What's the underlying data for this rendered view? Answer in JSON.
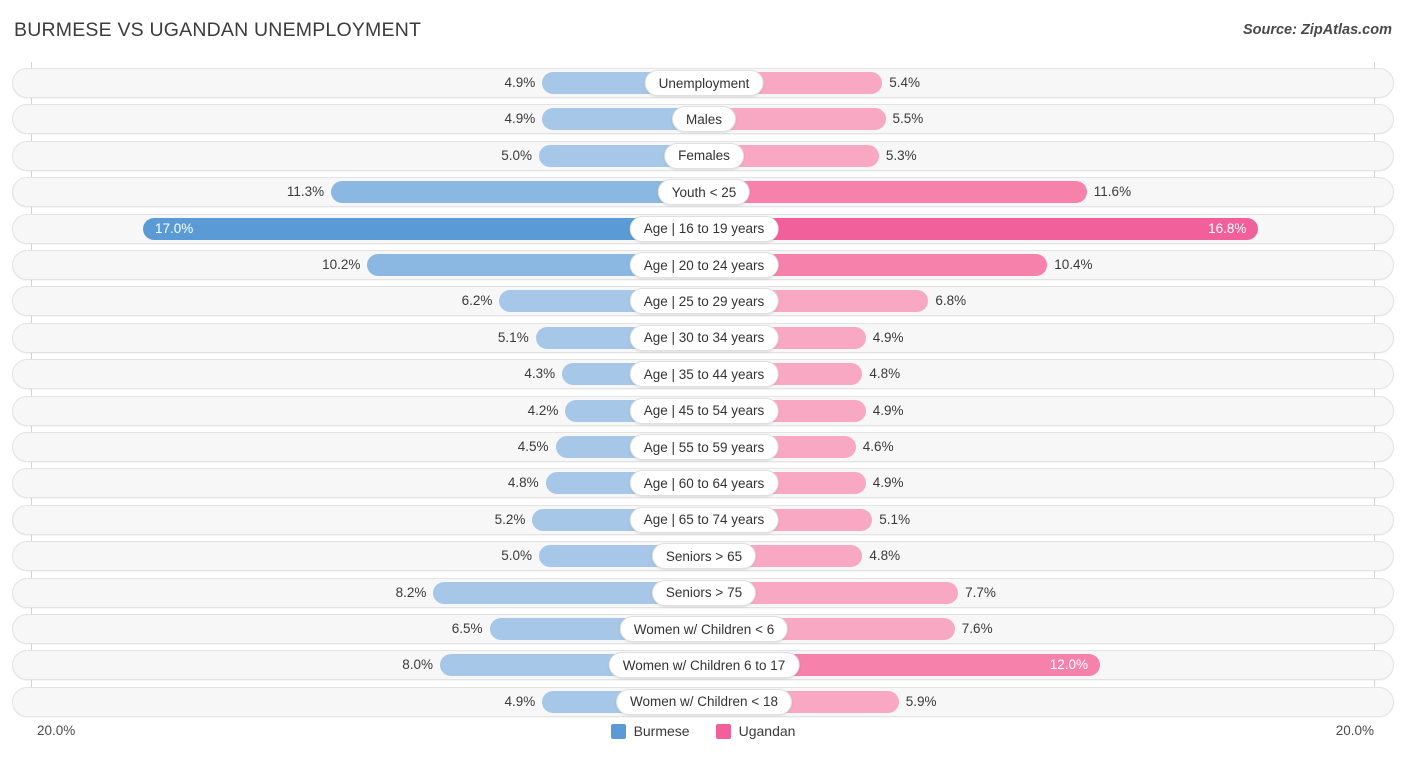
{
  "header": {
    "title": "BURMESE VS UGANDAN UNEMPLOYMENT",
    "source": "Source: ZipAtlas.com"
  },
  "legend": {
    "left": {
      "label": "Burmese",
      "color": "#5b9bd5"
    },
    "right": {
      "label": "Ugandan",
      "color": "#f2609b"
    }
  },
  "axis": {
    "left_label": "20.0%",
    "right_label": "20.0%",
    "max": 20.0
  },
  "chart_data": {
    "type": "bar",
    "orientation": "horizontal-diverging",
    "title": "BURMESE VS UGANDAN UNEMPLOYMENT",
    "xlabel": "",
    "ylabel": "",
    "xlim": [
      20.0,
      20.0
    ],
    "grid": false,
    "legend_position": "bottom-center",
    "categories": [
      "Unemployment",
      "Males",
      "Females",
      "Youth < 25",
      "Age | 16 to 19 years",
      "Age | 20 to 24 years",
      "Age | 25 to 29 years",
      "Age | 30 to 34 years",
      "Age | 35 to 44 years",
      "Age | 45 to 54 years",
      "Age | 55 to 59 years",
      "Age | 60 to 64 years",
      "Age | 65 to 74 years",
      "Seniors > 65",
      "Seniors > 75",
      "Women w/ Children < 6",
      "Women w/ Children 6 to 17",
      "Women w/ Children < 18"
    ],
    "series": [
      {
        "name": "Burmese",
        "color": "#5b9bd5",
        "values": [
          4.9,
          4.9,
          5.0,
          11.3,
          17.0,
          10.2,
          6.2,
          5.1,
          4.3,
          4.2,
          4.5,
          4.8,
          5.2,
          5.0,
          8.2,
          6.5,
          8.0,
          4.9
        ],
        "labels": [
          "4.9%",
          "4.9%",
          "5.0%",
          "11.3%",
          "17.0%",
          "10.2%",
          "6.2%",
          "5.1%",
          "4.3%",
          "4.2%",
          "4.5%",
          "4.8%",
          "5.2%",
          "5.0%",
          "8.2%",
          "6.5%",
          "8.0%",
          "4.9%"
        ]
      },
      {
        "name": "Ugandan",
        "color": "#f2609b",
        "values": [
          5.4,
          5.5,
          5.3,
          11.6,
          16.8,
          10.4,
          6.8,
          4.9,
          4.8,
          4.9,
          4.6,
          4.9,
          5.1,
          4.8,
          7.7,
          7.6,
          12.0,
          5.9
        ],
        "labels": [
          "5.4%",
          "5.5%",
          "5.3%",
          "11.6%",
          "16.8%",
          "10.4%",
          "6.8%",
          "4.9%",
          "4.8%",
          "4.9%",
          "4.6%",
          "4.9%",
          "5.1%",
          "4.8%",
          "7.7%",
          "7.6%",
          "12.0%",
          "5.9%"
        ]
      }
    ]
  }
}
